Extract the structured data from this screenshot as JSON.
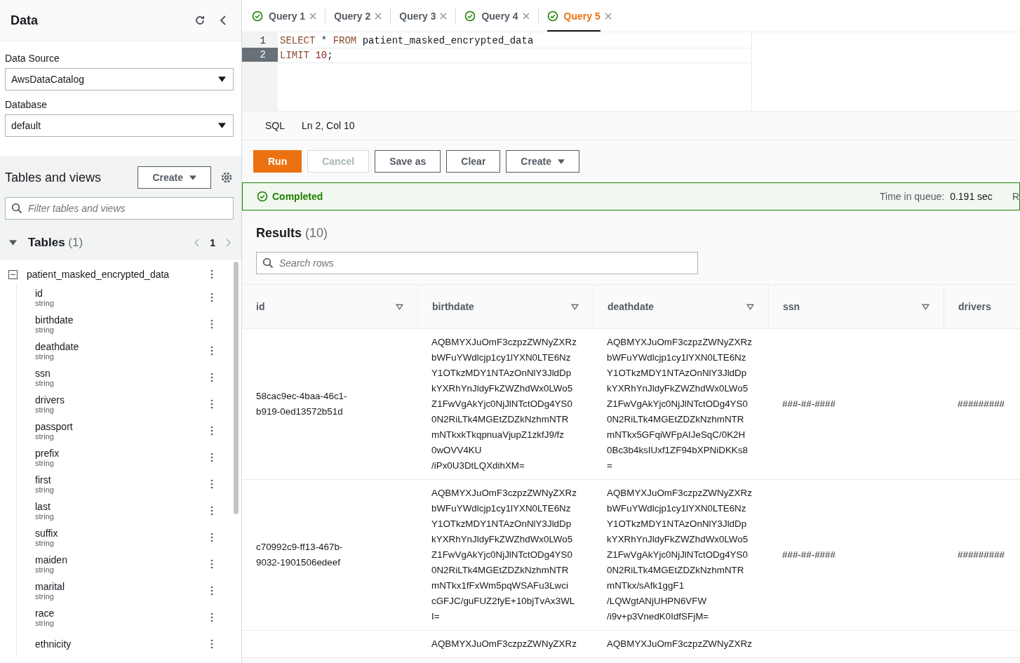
{
  "sidebar": {
    "title": "Data",
    "data_source": {
      "label": "Data Source",
      "value": "AwsDataCatalog"
    },
    "database": {
      "label": "Database",
      "value": "default"
    },
    "tables_and_views": {
      "title": "Tables and views",
      "create_button": "Create",
      "filter_placeholder": "Filter tables and views"
    },
    "tables": {
      "title": "Tables",
      "count": "(1)",
      "expanded": true,
      "page": "1",
      "tree": [
        {
          "name": "patient_masked_encrypted_data",
          "expanded": true,
          "children": [
            {
              "name": "id",
              "type": "string"
            },
            {
              "name": "birthdate",
              "type": "string"
            },
            {
              "name": "deathdate",
              "type": "string"
            },
            {
              "name": "ssn",
              "type": "string"
            },
            {
              "name": "drivers",
              "type": "string"
            },
            {
              "name": "passport",
              "type": "string"
            },
            {
              "name": "prefix",
              "type": "string"
            },
            {
              "name": "first",
              "type": "string"
            },
            {
              "name": "last",
              "type": "string"
            },
            {
              "name": "suffix",
              "type": "string"
            },
            {
              "name": "maiden",
              "type": "string"
            },
            {
              "name": "marital",
              "type": "string"
            },
            {
              "name": "race",
              "type": "string"
            },
            {
              "name": "ethnicity"
            }
          ]
        }
      ]
    }
  },
  "tabs": [
    {
      "label": "Query 1",
      "completed": true,
      "selected": false
    },
    {
      "label": "Query 2",
      "completed": false,
      "selected": false
    },
    {
      "label": "Query 3",
      "completed": false,
      "selected": false
    },
    {
      "label": "Query 4",
      "completed": true,
      "selected": false
    },
    {
      "label": "Query 5",
      "completed": true,
      "selected": true
    }
  ],
  "editor": {
    "lines": [
      {
        "number": "1",
        "kind": "select",
        "current": false,
        "k1": "SELECT",
        "mid": " * ",
        "k2": "FROM",
        "rest": " patient_masked_encrypted_data"
      },
      {
        "number": "2",
        "kind": "limit",
        "current": true,
        "k1": "LIMIT",
        "num": "10",
        "rest": ";"
      }
    ],
    "language": "SQL",
    "position": "Ln 2, Col 10"
  },
  "buttons": [
    {
      "label": "Run",
      "kind": "primary",
      "disabled": false
    },
    {
      "label": "Cancel",
      "kind": "normal",
      "disabled": true
    },
    {
      "label": "Save as",
      "kind": "normal",
      "disabled": false
    },
    {
      "label": "Clear",
      "kind": "normal",
      "disabled": false
    },
    {
      "label": "Create",
      "kind": "dropdown",
      "disabled": false
    }
  ],
  "status": {
    "text": "Completed",
    "queue_label": "Time in queue:",
    "queue_value": "0.191 sec",
    "next_label": "R"
  },
  "results": {
    "title": "Results",
    "count": "(10)",
    "search_placeholder": "Search rows",
    "columns": [
      "id",
      "birthdate",
      "deathdate",
      "ssn",
      "drivers"
    ],
    "rows": [
      [
        "58cac9ec-4baa-46c1-\nb919-0ed13572b51d",
        "AQBMYXJuOmF3czpzZWNyZXRz\nbWFuYWdlcjp1cy1lYXN0LTE6Nz\nY1OTkzMDY1NTAzOnNlY3JldDp\nkYXRhYnJldyFkZWZhdWx0LWo5\nZ1FwVgAkYjc0NjJlNTctODg4YS0\n0N2RiLTk4MGEtZDZkNzhmNTR\nmNTkxkTkqpnuaVjupZ1zkfJ9/fz\n0wOVV4KU\n/iPx0U3DtLQXdihXM=",
        "AQBMYXJuOmF3czpzZWNyZXRz\nbWFuYWdlcjp1cy1lYXN0LTE6Nz\nY1OTkzMDY1NTAzOnNlY3JldDp\nkYXRhYnJldyFkZWZhdWx0LWo5\nZ1FwVgAkYjc0NjJlNTctODg4YS0\n0N2RiLTk4MGEtZDZkNzhmNTR\nmNTkx5GFqiWFpAIJeSqC/0K2H\n0Bc3b4ksIUxf1ZF94bXPNiDKKs8\n=",
        "###-##-####",
        "#########"
      ],
      [
        "c70992c9-ff13-467b-\n9032-1901506edeef",
        "AQBMYXJuOmF3czpzZWNyZXRz\nbWFuYWdlcjp1cy1lYXN0LTE6Nz\nY1OTkzMDY1NTAzOnNlY3JldDp\nkYXRhYnJldyFkZWZhdWx0LWo5\nZ1FwVgAkYjc0NjJlNTctODg4YS0\n0N2RiLTk4MGEtZDZkNzhmNTR\nmNTkx1fFxWm5pqWSAFu3Lwci\ncGFJC/guFUZ2fyE+10bjTvAx3WL\nI=",
        "AQBMYXJuOmF3czpzZWNyZXRz\nbWFuYWdlcjp1cy1lYXN0LTE6Nz\nY1OTkzMDY1NTAzOnNlY3JldDp\nkYXRhYnJldyFkZWZhdWx0LWo5\nZ1FwVgAkYjc0NjJlNTctODg4YS0\n0N2RiLTk4MGEtZDZkNzhmNTR\nmNTkx/sAfk1ggF1\n/LQWgtANjUHPN6VFW\n/i9v+p3VnedK0IdfSFjM=",
        "###-##-####",
        "#########"
      ],
      [
        "",
        "AQBMYXJuOmF3czpzZWNyZXRz",
        "AQBMYXJuOmF3czpzZWNyZXRz",
        "",
        ""
      ]
    ]
  }
}
